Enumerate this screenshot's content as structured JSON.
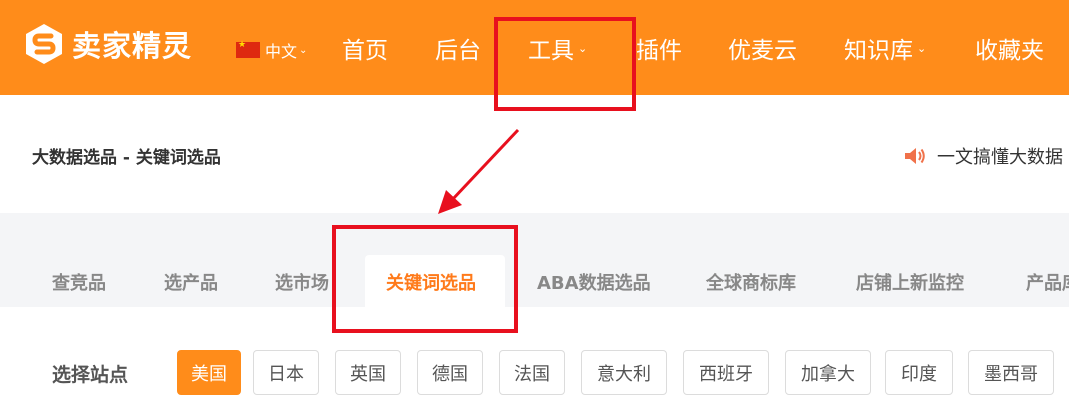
{
  "header": {
    "logo_text": "卖家精灵",
    "lang_label": "中文",
    "nav": [
      {
        "label": "首页"
      },
      {
        "label": "后台"
      },
      {
        "label": "工具"
      },
      {
        "label": "插件"
      },
      {
        "label": "优麦云"
      },
      {
        "label": "知识库"
      },
      {
        "label": "收藏夹"
      }
    ]
  },
  "breadcrumb": "大数据选品 - 关键词选品",
  "notice": "一文搞懂大数据",
  "tabs": [
    {
      "label": "查竞品"
    },
    {
      "label": "选产品"
    },
    {
      "label": "选市场"
    },
    {
      "label": "关键词选品"
    },
    {
      "label": "ABA数据选品"
    },
    {
      "label": "全球商标库"
    },
    {
      "label": "店铺上新监控"
    },
    {
      "label": "产品库"
    }
  ],
  "site_selector": {
    "label": "选择站点",
    "options": [
      "美国",
      "日本",
      "英国",
      "德国",
      "法国",
      "意大利",
      "西班牙",
      "加拿大",
      "印度",
      "墨西哥"
    ],
    "selected": "美国"
  },
  "colors": {
    "brand": "#ff8c1a",
    "highlight": "#e8101e",
    "active_tab": "#ff7a1a"
  }
}
